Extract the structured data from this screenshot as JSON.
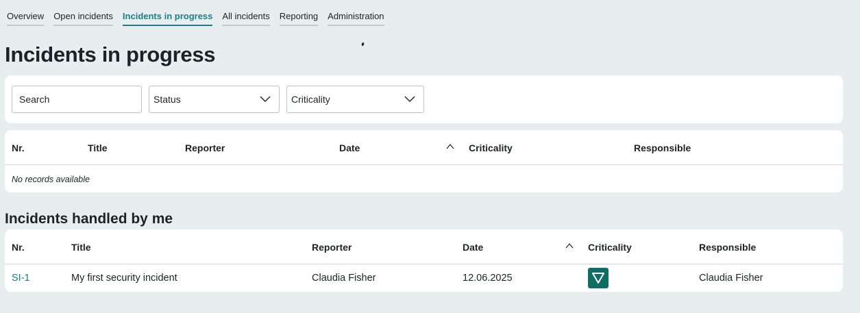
{
  "nav": {
    "tabs": [
      {
        "label": "Overview"
      },
      {
        "label": "Open incidents"
      },
      {
        "label": "Incidents in progress"
      },
      {
        "label": "All incidents"
      },
      {
        "label": "Reporting"
      },
      {
        "label": "Administration"
      }
    ],
    "active_index": 2
  },
  "page": {
    "title": "Incidents in progress"
  },
  "filters": {
    "search_placeholder": "Search",
    "status_label": "Status",
    "criticality_label": "Criticality"
  },
  "table_in_progress": {
    "headers": [
      "Nr.",
      "Title",
      "Reporter",
      "Date",
      "Criticality",
      "Responsible"
    ],
    "empty_text": "No records available"
  },
  "table_handled": {
    "title": "Incidents handled by me",
    "headers": [
      "Nr.",
      "Title",
      "Reporter",
      "Date",
      "Criticality",
      "Responsible"
    ],
    "rows": [
      {
        "nr": "SI-1",
        "title": "My first security incident",
        "reporter": "Claudia Fisher",
        "date": "12.06.2025",
        "criticality_icon": "triangle-down-icon",
        "responsible": "Claudia Fisher"
      }
    ]
  },
  "colors": {
    "accent": "#1b7f85",
    "criticality_badge": "#0e6e63",
    "background": "#e8edf0"
  }
}
